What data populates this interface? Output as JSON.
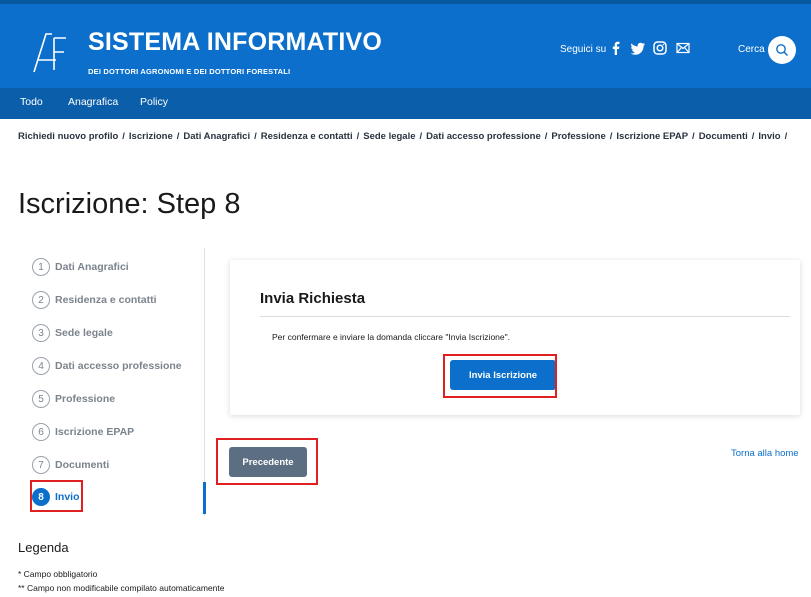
{
  "header": {
    "title": "SISTEMA INFORMATIVO",
    "subtitle": "DEI DOTTORI AGRONOMI E DEI DOTTORI FORESTALI",
    "follow_label": "Seguici su",
    "search_label": "Cerca",
    "accent": "#0b6fcb"
  },
  "nav": [
    "Todo",
    "Anagrafica",
    "Policy"
  ],
  "breadcrumb": [
    "Richiedi nuovo profilo",
    "Iscrizione",
    "Dati Anagrafici",
    "Residenza e contatti",
    "Sede legale",
    "Dati accesso professione",
    "Professione",
    "Iscrizione EPAP",
    "Documenti",
    "Invio"
  ],
  "breadcrumb_separator": "/",
  "page_title": "Iscrizione: Step 8",
  "steps": [
    {
      "num": "1",
      "label": "Dati Anagrafici"
    },
    {
      "num": "2",
      "label": "Residenza e contatti"
    },
    {
      "num": "3",
      "label": "Sede legale"
    },
    {
      "num": "4",
      "label": "Dati accesso professione"
    },
    {
      "num": "5",
      "label": "Professione"
    },
    {
      "num": "6",
      "label": "Iscrizione EPAP"
    },
    {
      "num": "7",
      "label": "Documenti"
    },
    {
      "num": "8",
      "label": "Invio"
    }
  ],
  "card": {
    "title": "Invia Richiesta",
    "text": "Per confermare e inviare la domanda cliccare \"Invia Iscrizione\".",
    "submit_label": "Invia Iscrizione"
  },
  "prev_label": "Precedente",
  "home_link": "Torna alla home",
  "legend": {
    "title": "Legenda",
    "lines": [
      "* Campo obbligatorio",
      "** Campo non modificabile compilato automaticamente"
    ]
  }
}
